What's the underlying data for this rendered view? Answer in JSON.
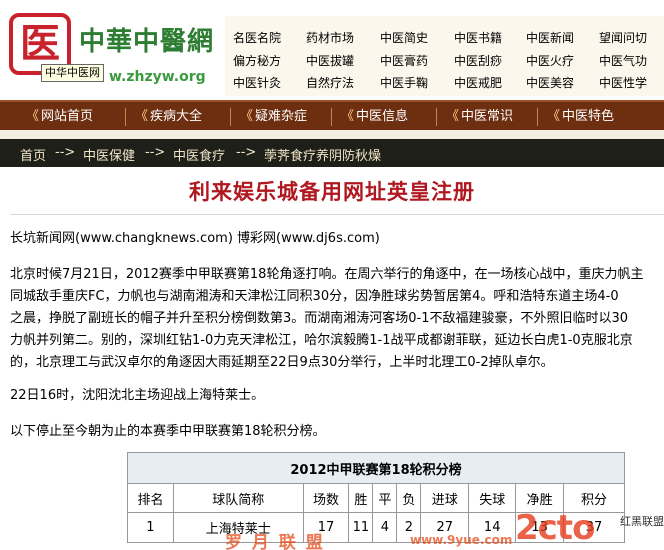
{
  "header": {
    "logo_glyph": "医",
    "logo_title": "中華中醫網",
    "logo_url": "w.zhzyw.org",
    "logo_tooltip": "中华中医网",
    "quick_links": [
      [
        "名医名院",
        "药材市场",
        "中医简史",
        "中医书籍",
        "中医新闻",
        "望闻问切"
      ],
      [
        "偏方秘方",
        "中医拔罐",
        "中医膏药",
        "中医刮痧",
        "中医火疗",
        "中医气功"
      ],
      [
        "中医针灸",
        "自然疗法",
        "中医手鞠",
        "中医戒肥",
        "中医美容",
        "中医性学"
      ]
    ]
  },
  "nav": {
    "arrows": "《",
    "items": [
      "网站首页",
      "疾病大全",
      "疑难杂症",
      "中医信息",
      "中医常识",
      "中医特色"
    ]
  },
  "breadcrumb": {
    "separator": "-->",
    "items": [
      "首页",
      "中医保健",
      "中医食疗",
      "荸荠食疗养阴防秋燥"
    ]
  },
  "article": {
    "title": "利来娱乐城备用网址英皇注册",
    "source": "长坑新闻网(www.changknews.com) 博彩网(www.dj6s.com)",
    "para1": [
      "北京时候7月21日，2012赛季中甲联赛第18轮角逐打响。在周六举行的角逐中，在一场核心战中，重庆力帆主",
      "同城敌手重庆FC，力帆也与湖南湘涛和天津松江同积30分，因净胜球劣势暂居第4。呼和浩特东道主场4-0",
      "之晨，挣脱了副班长的帽子并升至积分榜倒数第3。而湖南湘涛河客场0-1不敌福建骏豪，不外照旧临时以30",
      "力帆并列第二。别的，深圳红钻1-0力克天津松江，哈尔滨毅腾1-1战平成都谢菲联，延边长白虎1-0克服北京",
      "的，北京理工与武汉卓尔的角逐因大雨延期至22日9点30分举行，上半时北理工0-2掉队卓尔。"
    ],
    "para2": "22日16时，沈阳沈北主场迎战上海特莱士。",
    "para3": "以下停止至今朝为止的本赛季中甲联赛第18轮积分榜。"
  },
  "standings": {
    "caption": "2012中甲联赛第18轮积分榜",
    "headers": [
      "排名",
      "球队简称",
      "场数",
      "胜",
      "平",
      "负",
      "进球",
      "失球",
      "净胜",
      "积分"
    ],
    "rows": [
      [
        "1",
        "上海特莱士",
        "17",
        "11",
        "4",
        "2",
        "27",
        "14",
        "13",
        "37"
      ]
    ]
  },
  "watermark": {
    "left": "罗 月 联 盟",
    "mid": "www.9yue.com",
    "logo": "2cto",
    "right": "红黑联盟",
    "color": "#e54b1a"
  },
  "colors": {
    "nav_bg": "#6e2e10",
    "breadcrumb_bg": "#1f1f1a",
    "title_red": "#b0171f",
    "logo_green": "#2d7d32",
    "seal_red": "#c8232c"
  }
}
